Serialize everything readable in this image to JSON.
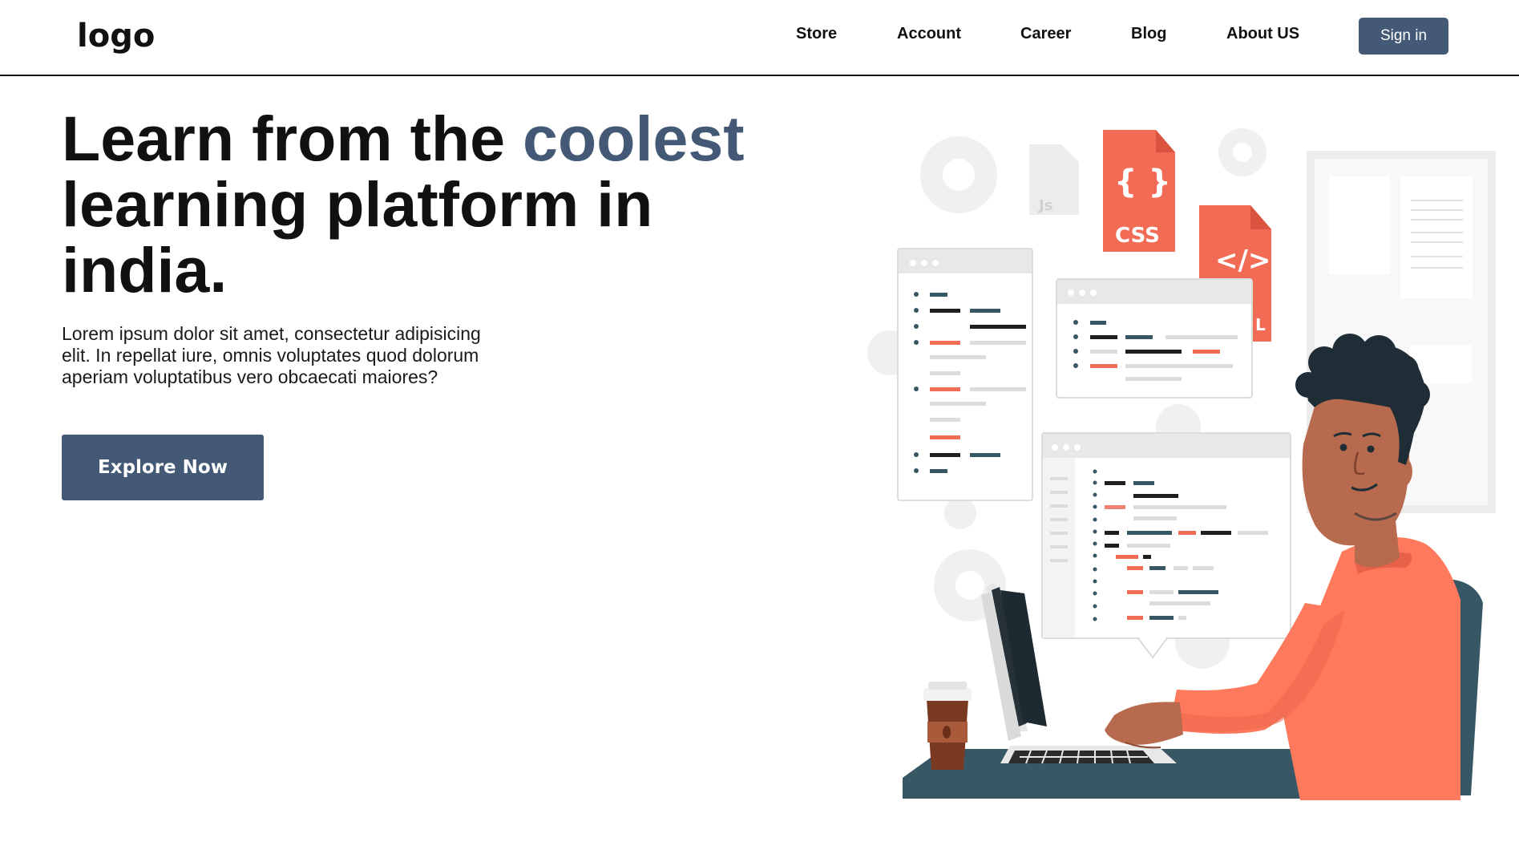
{
  "header": {
    "logo": "logo",
    "nav": [
      "Store",
      "Account",
      "Career",
      "Blog",
      "About US"
    ],
    "signin_label": "Sign in"
  },
  "hero": {
    "title_before": "Learn from the ",
    "title_accent": "coolest",
    "title_after": " learning platform in india.",
    "description": "Lorem ipsum dolor sit amet, consectetur adipisicing elit. In repellat iure, omnis voluptates quod dolorum aperiam voluptatibus vero obcaecati maiores?",
    "cta_label": "Explore Now"
  },
  "illustration": {
    "file_labels": {
      "js": "Js",
      "css": "CSS",
      "html": "</>",
      "html_suffix": "L",
      "braces": "{ }"
    }
  },
  "colors": {
    "accent": "#435976",
    "coral": "#f26b55",
    "dark_teal": "#375765",
    "shirt": "#ff7a5c",
    "skin": "#b86a4e",
    "hair": "#1f2e36"
  }
}
